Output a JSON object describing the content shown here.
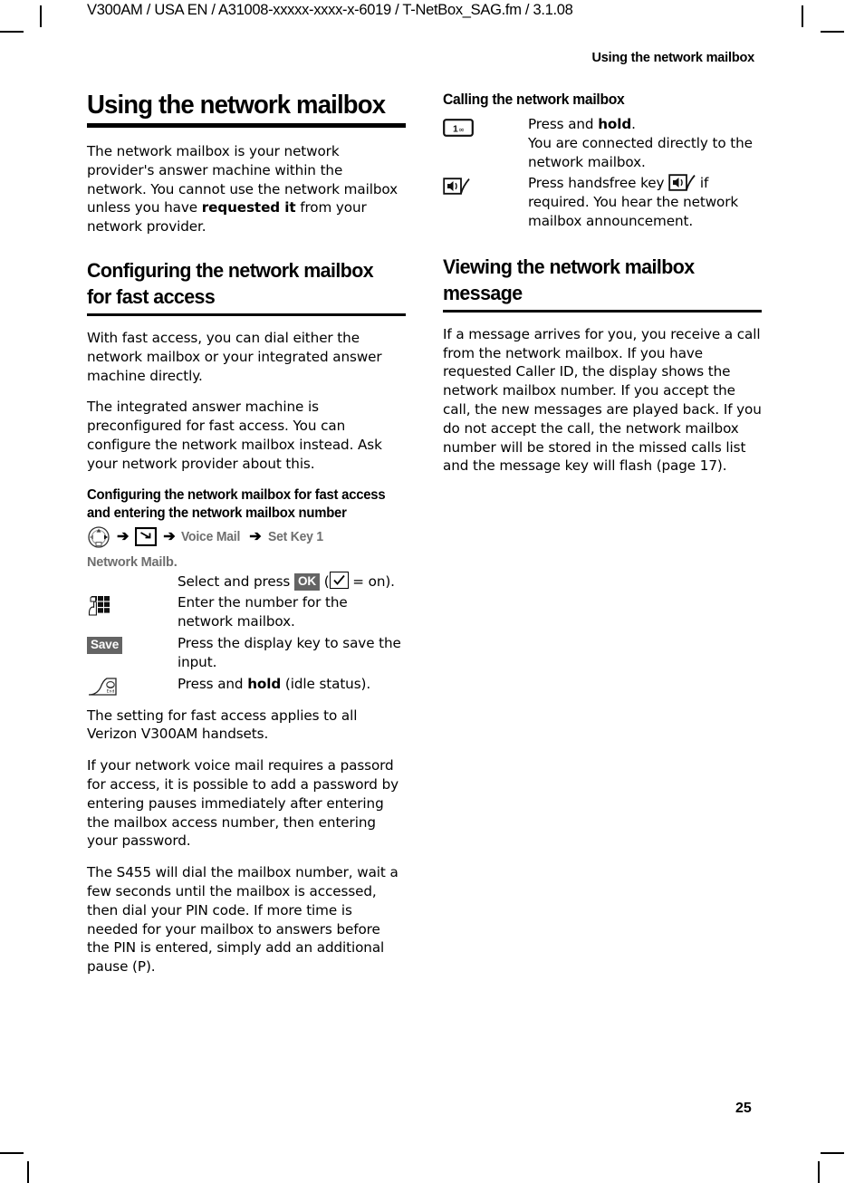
{
  "header": {
    "file_info": "V300AM / USA EN / A31008-xxxxx-xxxx-x-6019 / T-NetBox_SAG.fm / 3.1.08",
    "running_head": "Using the network mailbox"
  },
  "folio": {
    "page_number": "25"
  },
  "left_column": {
    "title": "Using the network mailbox",
    "intro_before_bold": "The network mailbox is your network provider's answer machine within the network. You cannot use the network mailbox unless you have ",
    "intro_bold": "requested it",
    "intro_after_bold": " from your network provider.",
    "section_heading": "Configuring the network mailbox for fast access",
    "paragraph_1": "With fast access, you can dial either the network mailbox or your integrated answer machine directly.",
    "paragraph_2": "The integrated answer machine is preconfigured for fast access. You can configure the network mailbox instead. Ask your network provider about this.",
    "subheading": "Configuring the network mailbox for fast access and entering the network mailbox number",
    "menu_path": {
      "nav_icon": "navigation-key-icon",
      "arrow": "➔",
      "message_icon": "message-key-icon",
      "item_1": "Voice Mail",
      "item_2": "Set Key 1"
    },
    "menu_selected_item": "Network Mailb.",
    "steps": [
      {
        "icon": "none",
        "text_before_badge": "Select and press ",
        "badge": "OK",
        "text_after_badge": " (",
        "checkbox_icon": "checkbox-checked-icon",
        "text_end": " = on)."
      },
      {
        "icon": "keypad-icon",
        "text": "Enter the number for the network mailbox."
      },
      {
        "icon": "save-softkey-badge",
        "badge": "Save",
        "text": "Press the display key to save the input."
      },
      {
        "icon": "end-key-icon",
        "text_before_bold": "Press and ",
        "text_bold": "hold",
        "text_after_bold": " (idle status)."
      }
    ],
    "paragraph_3": "The setting for fast access applies to all Verizon V300AM handsets.",
    "paragraph_4": "If your network voice mail requires a passord for access, it is possible to add a password by entering pauses immediately after entering the mailbox access number, then entering your password.",
    "paragraph_5": "The S455 will dial the mailbox number, wait a few seconds until the mailbox is accessed, then dial your PIN code.  If more time is needed for your mailbox to answers before the PIN is entered, simply add an additional pause (P)."
  },
  "right_column": {
    "subheading": "Calling the network mailbox",
    "steps": [
      {
        "icon": "key-1-icon",
        "text_before_bold": "Press and ",
        "text_bold": "hold",
        "text_after_bold": ".",
        "text_line2": "You are connected directly to the network mailbox."
      },
      {
        "icon": "handsfree-key-icon",
        "text_before_icon": "Press handsfree key ",
        "inline_icon": "handsfree-key-icon",
        "text_after_icon": " if required. You hear the network mailbox announcement."
      }
    ],
    "section_heading": "Viewing the network mailbox message",
    "paragraph_1": "If a message arrives for you, you receive a call from the network mailbox. If you have requested Caller ID, the display shows the network mailbox number. If you accept the call, the new messages are played back. If you do not accept the call, the network mailbox number will be stored in the missed calls list and the message key will flash (page 17)."
  },
  "colors": {
    "text": "#000000",
    "menu_gray": "#6e6e6e",
    "badge_bg": "#646464",
    "badge_text": "#ffffff"
  }
}
